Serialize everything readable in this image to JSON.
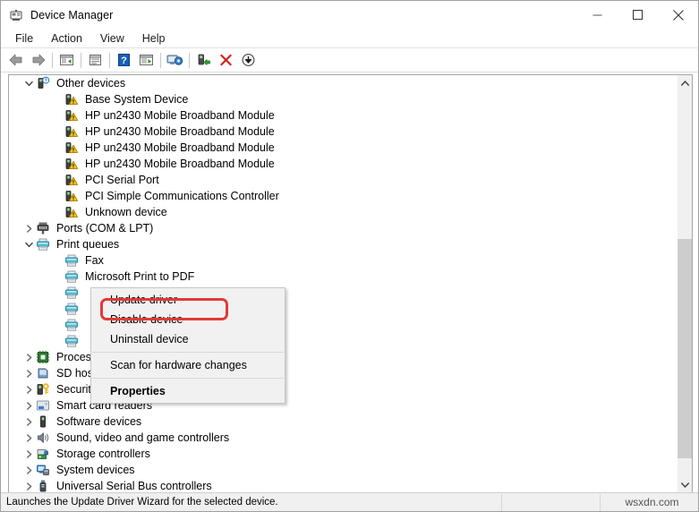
{
  "window": {
    "title": "Device Manager",
    "icon": "device-manager-icon",
    "minimize_label": "Minimize",
    "maximize_label": "Maximize",
    "close_label": "Close"
  },
  "menubar": {
    "items": [
      {
        "label": "File"
      },
      {
        "label": "Action"
      },
      {
        "label": "View"
      },
      {
        "label": "Help"
      }
    ]
  },
  "toolbar": {
    "buttons": [
      {
        "name": "back-icon",
        "tooltip": "Back"
      },
      {
        "name": "forward-icon",
        "tooltip": "Forward"
      },
      {
        "name": "show-hide-console-tree-icon",
        "tooltip": "Show/Hide Console Tree"
      },
      {
        "name": "properties-icon",
        "tooltip": "Properties"
      },
      {
        "name": "help-icon",
        "tooltip": "Help"
      },
      {
        "name": "update-driver-icon",
        "tooltip": "Update driver"
      },
      {
        "name": "scan-hardware-changes-icon",
        "tooltip": "Scan for hardware changes"
      },
      {
        "name": "enable-device-icon",
        "tooltip": "Enable device"
      },
      {
        "name": "uninstall-device-icon",
        "tooltip": "Uninstall device"
      },
      {
        "name": "disable-device-icon",
        "tooltip": "Disable device"
      }
    ]
  },
  "tree": {
    "rows": [
      {
        "label": "Other devices",
        "indent": 0,
        "chevron": "down",
        "icon": "unknown-device-icon",
        "selected": false
      },
      {
        "label": "Base System Device",
        "indent": 1,
        "chevron": "none",
        "icon": "warning-device-icon",
        "selected": false
      },
      {
        "label": "HP un2430 Mobile Broadband Module",
        "indent": 1,
        "chevron": "none",
        "icon": "warning-device-icon",
        "selected": false
      },
      {
        "label": "HP un2430 Mobile Broadband Module",
        "indent": 1,
        "chevron": "none",
        "icon": "warning-device-icon",
        "selected": false
      },
      {
        "label": "HP un2430 Mobile Broadband Module",
        "indent": 1,
        "chevron": "none",
        "icon": "warning-device-icon",
        "selected": false
      },
      {
        "label": "HP un2430 Mobile Broadband Module",
        "indent": 1,
        "chevron": "none",
        "icon": "warning-device-icon",
        "selected": false
      },
      {
        "label": "PCI Serial Port",
        "indent": 1,
        "chevron": "none",
        "icon": "warning-device-icon",
        "selected": false
      },
      {
        "label": "PCI Simple Communications Controller",
        "indent": 1,
        "chevron": "none",
        "icon": "warning-device-icon",
        "selected": false
      },
      {
        "label": "Unknown device",
        "indent": 1,
        "chevron": "none",
        "icon": "warning-device-icon",
        "selected": false
      },
      {
        "label": "Ports (COM & LPT)",
        "indent": 0,
        "chevron": "right",
        "icon": "port-icon",
        "selected": false
      },
      {
        "label": "Print queues",
        "indent": 0,
        "chevron": "down",
        "icon": "printer-icon",
        "selected": false
      },
      {
        "label": "Fax",
        "indent": 1,
        "chevron": "none",
        "icon": "printer-icon",
        "selected": false
      },
      {
        "label": "Microsoft Print to PDF",
        "indent": 1,
        "chevron": "none",
        "icon": "printer-icon",
        "selected": false
      },
      {
        "label": "",
        "indent": 1,
        "chevron": "none",
        "icon": "printer-icon",
        "selected": true
      },
      {
        "label": "",
        "indent": 1,
        "chevron": "none",
        "icon": "printer-icon",
        "selected": false
      },
      {
        "label": "",
        "indent": 1,
        "chevron": "none",
        "icon": "printer-icon",
        "selected": false
      },
      {
        "label": "",
        "indent": 1,
        "chevron": "none",
        "icon": "printer-icon",
        "selected": false
      },
      {
        "label": "Processors",
        "indent": 0,
        "chevron": "right",
        "icon": "processor-icon",
        "selected": false
      },
      {
        "label": "SD host adapters",
        "indent": 0,
        "chevron": "right",
        "icon": "sd-host-icon",
        "selected": false
      },
      {
        "label": "Security devices",
        "indent": 0,
        "chevron": "right",
        "icon": "security-icon",
        "selected": false
      },
      {
        "label": "Smart card readers",
        "indent": 0,
        "chevron": "right",
        "icon": "smartcard-icon",
        "selected": false
      },
      {
        "label": "Software devices",
        "indent": 0,
        "chevron": "right",
        "icon": "software-device-icon",
        "selected": false
      },
      {
        "label": "Sound, video and game controllers",
        "indent": 0,
        "chevron": "right",
        "icon": "sound-icon",
        "selected": false
      },
      {
        "label": "Storage controllers",
        "indent": 0,
        "chevron": "right",
        "icon": "storage-icon",
        "selected": false
      },
      {
        "label": "System devices",
        "indent": 0,
        "chevron": "right",
        "icon": "system-device-icon",
        "selected": false
      },
      {
        "label": "Universal Serial Bus controllers",
        "indent": 0,
        "chevron": "right",
        "icon": "usb-icon",
        "selected": false
      }
    ]
  },
  "context_menu": {
    "items": [
      {
        "label": "Update driver",
        "bold": false,
        "highlighted": true
      },
      {
        "label": "Disable device",
        "bold": false,
        "highlighted": false
      },
      {
        "label": "Uninstall device",
        "bold": false,
        "highlighted": false
      },
      {
        "separator": true
      },
      {
        "label": "Scan for hardware changes",
        "bold": false,
        "highlighted": false
      },
      {
        "separator": true
      },
      {
        "label": "Properties",
        "bold": true,
        "highlighted": false
      }
    ],
    "highlight_color": "#e03b36"
  },
  "statusbar": {
    "message": "Launches the Update Driver Wizard for the selected device.",
    "middle": "",
    "watermark": "wsxdn.com"
  },
  "scrollbar": {
    "up_arrow": "chevron-up-icon",
    "down_arrow": "chevron-down-icon"
  }
}
